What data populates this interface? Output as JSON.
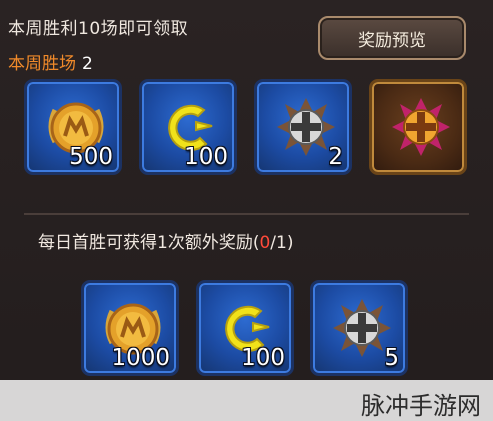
{
  "weekly": {
    "title": "本周胜利10场即可领取",
    "wins_label": "本周胜场",
    "wins_value": "2",
    "preview_button": "奖励预览",
    "rewards": [
      {
        "icon": "gold-medal-icon",
        "count": "500"
      },
      {
        "icon": "crescent-moon-icon",
        "count": "100"
      },
      {
        "icon": "silver-cross-emblem-icon",
        "count": "2"
      },
      {
        "icon": "gold-cross-emblem-icon",
        "count": ""
      }
    ]
  },
  "daily": {
    "text": "每日首胜可获得1次额外奖励(",
    "progress_current": "0",
    "progress_sep_total": "/1)",
    "rewards": [
      {
        "icon": "gold-medal-icon",
        "count": "1000"
      },
      {
        "icon": "crescent-moon-icon",
        "count": "100"
      },
      {
        "icon": "silver-cross-emblem-icon",
        "count": "5"
      }
    ]
  },
  "watermark": "脉冲手游网",
  "colors": {
    "accent_orange": "#f08a2a",
    "progress_red": "#ff4a3a",
    "slot_blue": "#1c4ba3",
    "special_brown": "#4a2a14"
  }
}
